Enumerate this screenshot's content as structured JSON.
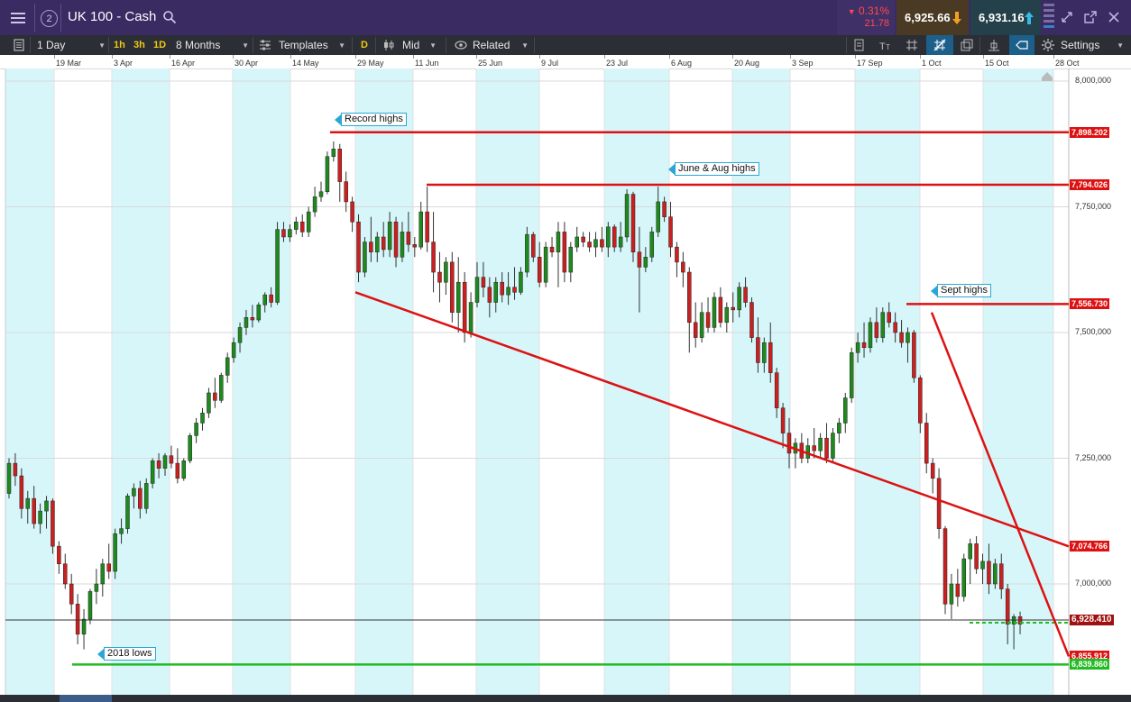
{
  "header": {
    "panel_count": "2",
    "instrument": "UK 100 - Cash",
    "change_pct": "0.31%",
    "change_abs": "21.78",
    "sell_price": "6,925.66",
    "buy_price": "6,931.16",
    "colors": {
      "down": "#ff4a4a",
      "sell_arrow": "#f0a020",
      "buy_arrow": "#38b8e8"
    }
  },
  "toolbar": {
    "interval": "1 Day",
    "quick_intervals": [
      "1h",
      "3h",
      "1D"
    ],
    "range": "8 Months",
    "templates": "Templates",
    "d_badge": "D",
    "price_type": "Mid",
    "related": "Related",
    "settings": "Settings",
    "icons": [
      "list-icon",
      "text-size-icon",
      "crosshair-grid-icon",
      "draw-tools-icon",
      "layers-icon",
      "indicator-icon",
      "price-tag-icon",
      "gear-icon"
    ]
  },
  "date_axis": [
    "19 Mar",
    "3 Apr",
    "16 Apr",
    "30 Apr",
    "14 May",
    "29 May",
    "11 Jun",
    "25 Jun",
    "9 Jul",
    "23 Jul",
    "6 Aug",
    "20 Aug",
    "3 Sep",
    "17 Sep",
    "1 Oct",
    "15 Oct",
    "28 Oct"
  ],
  "price_axis": [
    "8,000,000",
    "7,750,000",
    "7,500,000",
    "7,250,000",
    "7,000,000"
  ],
  "price_labels": {
    "record": "7,898.202",
    "june_aug": "7,794.026",
    "sept": "7,556.730",
    "trendline": "7,074.766",
    "current": "6,928.410",
    "support": "6,855.912",
    "lows": "6,839.860"
  },
  "annotations": {
    "record_highs": "Record highs",
    "june_aug_highs": "June & Aug highs",
    "sept_highs": "Sept highs",
    "lows_2018": "2018 lows"
  },
  "chart_data": {
    "type": "candlestick",
    "interval": "1 Day",
    "y_axis_range": [
      6800,
      8030
    ],
    "colors": {
      "up": "#1e8a1e",
      "down": "#cc1f1f",
      "level_line": "#dd1111",
      "support_line": "#22bb22",
      "shade": "#d6f6fa"
    },
    "candles": [
      [
        7180,
        7250,
        7170,
        7240
      ],
      [
        7240,
        7260,
        7195,
        7215
      ],
      [
        7215,
        7230,
        7130,
        7150
      ],
      [
        7150,
        7185,
        7120,
        7170
      ],
      [
        7170,
        7195,
        7110,
        7120
      ],
      [
        7120,
        7160,
        7100,
        7145
      ],
      [
        7145,
        7175,
        7110,
        7165
      ],
      [
        7165,
        7170,
        7060,
        7075
      ],
      [
        7075,
        7085,
        7020,
        7040
      ],
      [
        7040,
        7060,
        6990,
        7000
      ],
      [
        7000,
        7020,
        6940,
        6960
      ],
      [
        6960,
        6980,
        6880,
        6900
      ],
      [
        6900,
        6950,
        6870,
        6930
      ],
      [
        6930,
        6990,
        6920,
        6985
      ],
      [
        6985,
        7030,
        6960,
        7000
      ],
      [
        7000,
        7050,
        6975,
        7040
      ],
      [
        7040,
        7080,
        7010,
        7025
      ],
      [
        7025,
        7110,
        7010,
        7100
      ],
      [
        7100,
        7130,
        7080,
        7110
      ],
      [
        7110,
        7180,
        7100,
        7175
      ],
      [
        7175,
        7200,
        7150,
        7190
      ],
      [
        7190,
        7205,
        7130,
        7150
      ],
      [
        7150,
        7210,
        7140,
        7200
      ],
      [
        7200,
        7250,
        7190,
        7245
      ],
      [
        7245,
        7260,
        7210,
        7230
      ],
      [
        7230,
        7260,
        7215,
        7255
      ],
      [
        7255,
        7275,
        7230,
        7240
      ],
      [
        7240,
        7270,
        7200,
        7210
      ],
      [
        7210,
        7250,
        7205,
        7245
      ],
      [
        7245,
        7300,
        7240,
        7295
      ],
      [
        7295,
        7330,
        7280,
        7320
      ],
      [
        7320,
        7350,
        7305,
        7340
      ],
      [
        7340,
        7390,
        7330,
        7380
      ],
      [
        7380,
        7410,
        7350,
        7365
      ],
      [
        7365,
        7420,
        7360,
        7415
      ],
      [
        7415,
        7460,
        7400,
        7450
      ],
      [
        7450,
        7490,
        7440,
        7480
      ],
      [
        7480,
        7520,
        7460,
        7510
      ],
      [
        7510,
        7545,
        7495,
        7530
      ],
      [
        7530,
        7555,
        7510,
        7525
      ],
      [
        7525,
        7560,
        7520,
        7555
      ],
      [
        7555,
        7580,
        7540,
        7575
      ],
      [
        7575,
        7590,
        7550,
        7560
      ],
      [
        7560,
        7720,
        7555,
        7705
      ],
      [
        7705,
        7720,
        7680,
        7690
      ],
      [
        7690,
        7715,
        7680,
        7705
      ],
      [
        7705,
        7730,
        7695,
        7720
      ],
      [
        7720,
        7735,
        7690,
        7700
      ],
      [
        7700,
        7750,
        7690,
        7740
      ],
      [
        7740,
        7790,
        7730,
        7770
      ],
      [
        7770,
        7800,
        7760,
        7780
      ],
      [
        7780,
        7860,
        7775,
        7850
      ],
      [
        7850,
        7880,
        7840,
        7865
      ],
      [
        7865,
        7875,
        7760,
        7800
      ],
      [
        7800,
        7820,
        7740,
        7760
      ],
      [
        7760,
        7770,
        7700,
        7720
      ],
      [
        7720,
        7735,
        7600,
        7620
      ],
      [
        7620,
        7690,
        7610,
        7680
      ],
      [
        7680,
        7730,
        7640,
        7660
      ],
      [
        7660,
        7700,
        7640,
        7690
      ],
      [
        7690,
        7720,
        7650,
        7665
      ],
      [
        7665,
        7740,
        7650,
        7720
      ],
      [
        7720,
        7730,
        7630,
        7650
      ],
      [
        7650,
        7720,
        7640,
        7700
      ],
      [
        7700,
        7740,
        7660,
        7675
      ],
      [
        7675,
        7690,
        7650,
        7670
      ],
      [
        7670,
        7760,
        7665,
        7740
      ],
      [
        7740,
        7790,
        7660,
        7680
      ],
      [
        7680,
        7740,
        7580,
        7620
      ],
      [
        7620,
        7660,
        7560,
        7600
      ],
      [
        7600,
        7650,
        7575,
        7640
      ],
      [
        7640,
        7660,
        7520,
        7540
      ],
      [
        7540,
        7650,
        7500,
        7600
      ],
      [
        7600,
        7620,
        7480,
        7500
      ],
      [
        7500,
        7580,
        7490,
        7560
      ],
      [
        7560,
        7640,
        7550,
        7610
      ],
      [
        7610,
        7640,
        7570,
        7590
      ],
      [
        7590,
        7610,
        7530,
        7560
      ],
      [
        7560,
        7610,
        7540,
        7600
      ],
      [
        7600,
        7620,
        7560,
        7575
      ],
      [
        7575,
        7620,
        7555,
        7590
      ],
      [
        7590,
        7630,
        7565,
        7580
      ],
      [
        7580,
        7630,
        7575,
        7620
      ],
      [
        7620,
        7710,
        7610,
        7695
      ],
      [
        7695,
        7700,
        7640,
        7650
      ],
      [
        7650,
        7680,
        7590,
        7600
      ],
      [
        7600,
        7680,
        7590,
        7670
      ],
      [
        7670,
        7690,
        7650,
        7660
      ],
      [
        7660,
        7720,
        7590,
        7700
      ],
      [
        7700,
        7720,
        7600,
        7620
      ],
      [
        7620,
        7680,
        7600,
        7670
      ],
      [
        7670,
        7710,
        7660,
        7690
      ],
      [
        7690,
        7700,
        7670,
        7680
      ],
      [
        7680,
        7700,
        7660,
        7670
      ],
      [
        7670,
        7700,
        7650,
        7685
      ],
      [
        7685,
        7710,
        7660,
        7670
      ],
      [
        7670,
        7720,
        7650,
        7710
      ],
      [
        7710,
        7715,
        7660,
        7670
      ],
      [
        7670,
        7720,
        7660,
        7690
      ],
      [
        7690,
        7785,
        7680,
        7775
      ],
      [
        7775,
        7780,
        7640,
        7660
      ],
      [
        7660,
        7710,
        7540,
        7630
      ],
      [
        7630,
        7670,
        7620,
        7650
      ],
      [
        7650,
        7710,
        7640,
        7700
      ],
      [
        7700,
        7790,
        7690,
        7760
      ],
      [
        7760,
        7770,
        7720,
        7730
      ],
      [
        7730,
        7760,
        7650,
        7670
      ],
      [
        7670,
        7680,
        7610,
        7640
      ],
      [
        7640,
        7660,
        7590,
        7620
      ],
      [
        7620,
        7630,
        7460,
        7520
      ],
      [
        7520,
        7560,
        7470,
        7490
      ],
      [
        7490,
        7560,
        7480,
        7540
      ],
      [
        7540,
        7570,
        7500,
        7510
      ],
      [
        7510,
        7580,
        7500,
        7570
      ],
      [
        7570,
        7590,
        7510,
        7520
      ],
      [
        7520,
        7560,
        7500,
        7550
      ],
      [
        7550,
        7580,
        7520,
        7545
      ],
      [
        7545,
        7600,
        7530,
        7590
      ],
      [
        7590,
        7610,
        7550,
        7560
      ],
      [
        7560,
        7570,
        7480,
        7490
      ],
      [
        7490,
        7530,
        7420,
        7440
      ],
      [
        7440,
        7490,
        7420,
        7480
      ],
      [
        7480,
        7520,
        7400,
        7420
      ],
      [
        7420,
        7430,
        7330,
        7350
      ],
      [
        7350,
        7360,
        7270,
        7300
      ],
      [
        7300,
        7330,
        7230,
        7260
      ],
      [
        7260,
        7290,
        7230,
        7280
      ],
      [
        7280,
        7300,
        7240,
        7250
      ],
      [
        7250,
        7290,
        7240,
        7275
      ],
      [
        7275,
        7310,
        7250,
        7265
      ],
      [
        7265,
        7300,
        7250,
        7290
      ],
      [
        7290,
        7320,
        7240,
        7250
      ],
      [
        7250,
        7310,
        7240,
        7300
      ],
      [
        7300,
        7330,
        7280,
        7320
      ],
      [
        7320,
        7380,
        7300,
        7370
      ],
      [
        7370,
        7470,
        7360,
        7460
      ],
      [
        7460,
        7500,
        7440,
        7480
      ],
      [
        7480,
        7520,
        7450,
        7470
      ],
      [
        7470,
        7530,
        7460,
        7520
      ],
      [
        7520,
        7550,
        7480,
        7490
      ],
      [
        7490,
        7550,
        7480,
        7540
      ],
      [
        7540,
        7560,
        7510,
        7520
      ],
      [
        7520,
        7540,
        7480,
        7500
      ],
      [
        7500,
        7525,
        7470,
        7480
      ],
      [
        7480,
        7510,
        7440,
        7500
      ],
      [
        7500,
        7505,
        7400,
        7410
      ],
      [
        7410,
        7415,
        7300,
        7320
      ],
      [
        7320,
        7340,
        7220,
        7240
      ],
      [
        7240,
        7250,
        7180,
        7210
      ],
      [
        7210,
        7230,
        7090,
        7110
      ],
      [
        7110,
        7115,
        6940,
        6960
      ],
      [
        6960,
        7020,
        6930,
        7000
      ],
      [
        7000,
        7030,
        6955,
        6975
      ],
      [
        6975,
        7060,
        6965,
        7050
      ],
      [
        7050,
        7090,
        7000,
        7080
      ],
      [
        7080,
        7095,
        7020,
        7030
      ],
      [
        7030,
        7060,
        7000,
        7045
      ],
      [
        7045,
        7080,
        6980,
        7000
      ],
      [
        7000,
        7050,
        6990,
        7040
      ],
      [
        7040,
        7060,
        6970,
        6990
      ],
      [
        6990,
        7000,
        6880,
        6920
      ],
      [
        6920,
        6940,
        6870,
        6935
      ],
      [
        6935,
        6945,
        6900,
        6920
      ]
    ]
  }
}
